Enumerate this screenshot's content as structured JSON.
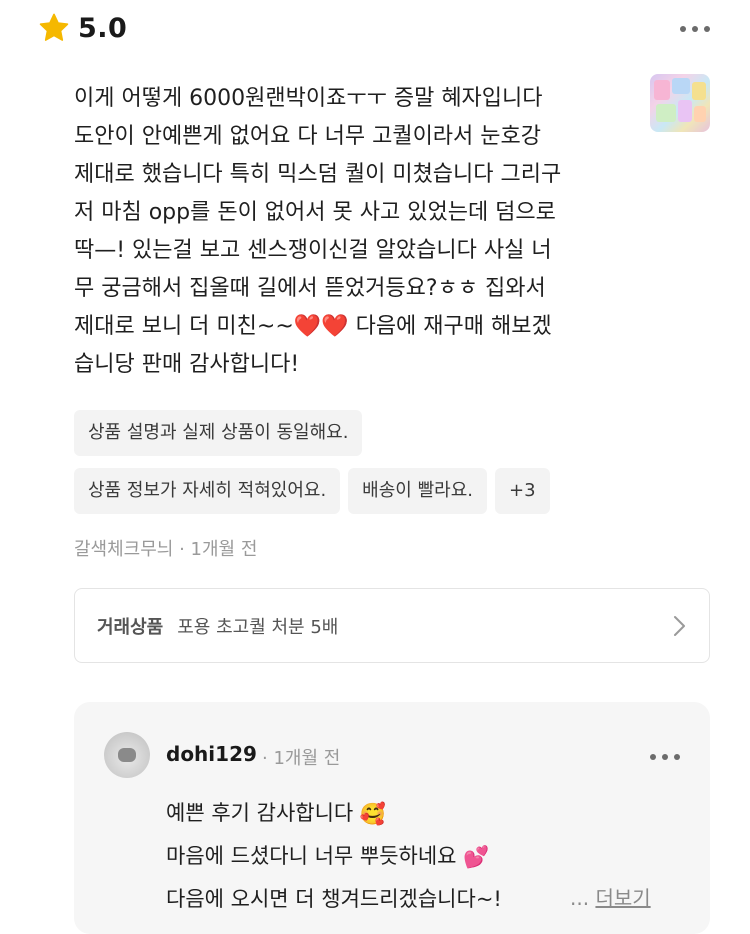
{
  "rating": {
    "score": "5.0",
    "icon": "star-icon",
    "color": "#F5B800"
  },
  "review": {
    "lines": [
      "이게 어떻게 6000원랜박이죠ㅜㅜ 증말 혜자입니다",
      "도안이 안예쁜게 없어요 다 너무 고퀄이라서 눈호강",
      "제대로 했습니다 특히 믹스덤 퀄이 미쳤습니다 그리구",
      "저 마침 opp를 돈이 없어서 못 사고 있었는데 덤으로",
      "딱—! 있는걸 보고 센스쟁이신걸 알았습니다 사실 너",
      "무 궁금해서 집올때 길에서 뜯었거등요?ㅎㅎ 집와서",
      "제대로 보니 더 미친~~",
      "다음에 재구매 해보겠",
      "습니당 판매 감사합니다!"
    ],
    "hearts": "❤️❤️"
  },
  "tags": {
    "row1": [
      "상품 설명과 실제 상품이 동일해요."
    ],
    "row2": [
      "상품 정보가 자세히 적혀있어요.",
      "배송이 빨라요.",
      "+3"
    ]
  },
  "meta": {
    "author": "갈색체크무늬",
    "time": "· 1개월 전"
  },
  "product": {
    "label": "거래상품",
    "name": "포용 초고퀄 처분 5배"
  },
  "reply": {
    "author": "dohi129",
    "time": "· 1개월 전",
    "line1": "예쁜 후기 감사합니다",
    "line2": "마음에 드셨다니 너무 뿌듯하네요",
    "line3": "다음에 오시면 더 챙겨드리겠습니다~!",
    "see_more_dots": "...",
    "see_more": "더보기"
  }
}
